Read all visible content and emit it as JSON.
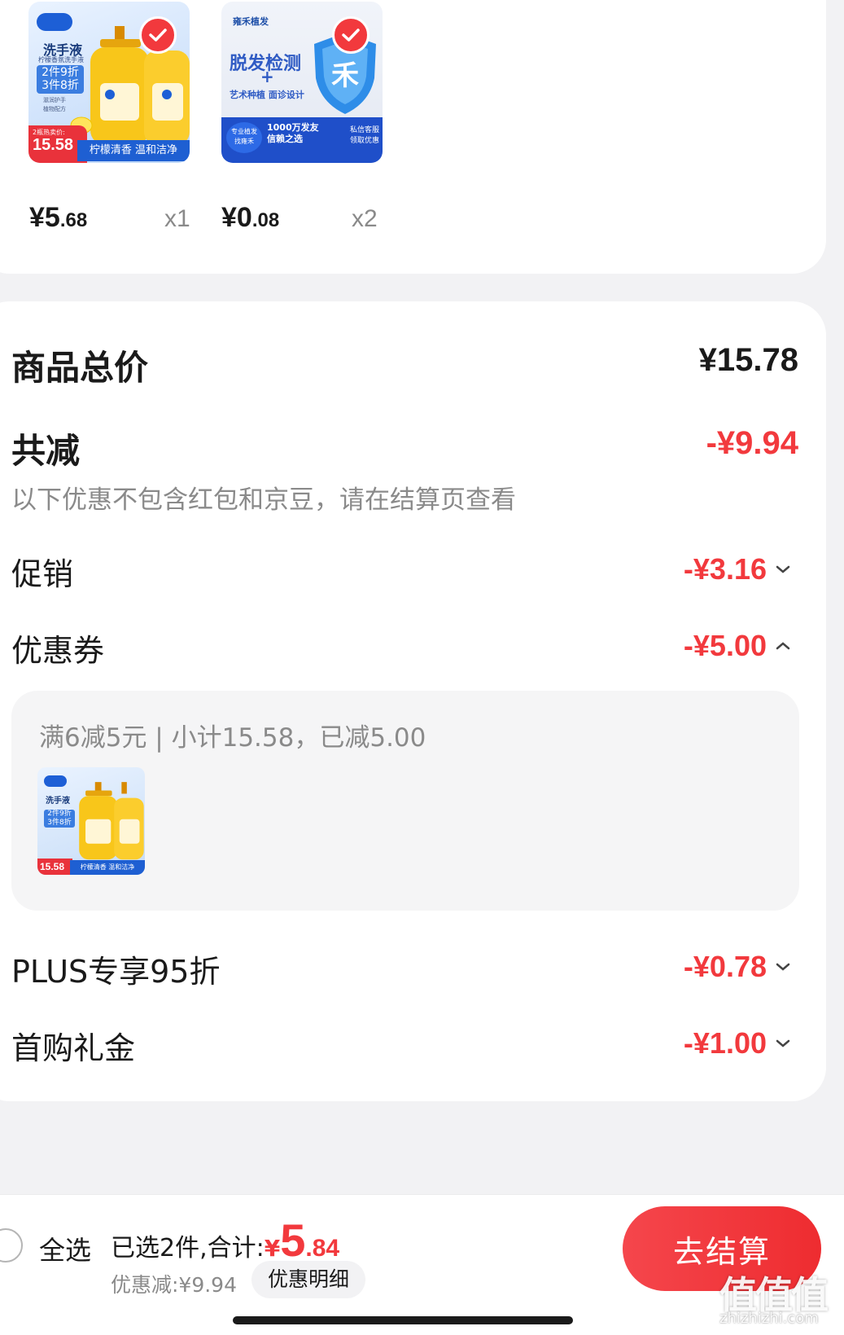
{
  "colors": {
    "accent": "#f2393d",
    "text": "#1a1a1a",
    "muted": "#8a8a8a"
  },
  "products": [
    {
      "badge": "洗手液",
      "sub": "柠檬香氛洗手液",
      "promo1": "2件9折",
      "promo2": "3件8折",
      "tag1": "滋润护手",
      "tag2": "植物配方",
      "price_tag_label": "2瓶热卖价:",
      "price_tag": "15.58",
      "banner": "柠檬清香 温和洁净",
      "price_int": "¥5",
      "price_dec": ".68",
      "qty": "x1"
    },
    {
      "brand": "雍禾植发",
      "title": "脱发检测",
      "plus": "+",
      "subtitle": "艺术种植 面诊设计",
      "chip1": "专业植发",
      "chip2": "找雍禾",
      "trust": "1000万发友",
      "trust2": "信赖之选",
      "service": "私信客服",
      "service2": "领取优惠",
      "price_int": "¥0",
      "price_dec": ".08",
      "qty": "x2"
    }
  ],
  "summary": {
    "total_label": "商品总价",
    "total_value": "¥15.78",
    "discount_label": "共减",
    "discount_value": "-¥9.94",
    "note": "以下优惠不包含红包和京豆，请在结算页查看",
    "rows": [
      {
        "label": "促销",
        "value": "-¥3.16"
      },
      {
        "label": "优惠券",
        "value": "-¥5.00"
      },
      {
        "label": "PLUS专享95折",
        "value": "-¥0.78"
      },
      {
        "label": "首购礼金",
        "value": "-¥1.00"
      }
    ],
    "coupon_detail": "满6减5元 | 小计15.58，已减5.00"
  },
  "bottom_bar": {
    "select_all": "全选",
    "selected_text": "已选2件,合计:",
    "total_symbol": "¥",
    "total_int": "5",
    "total_dec": ".84",
    "saved": "优惠减:¥9.94",
    "detail_button": "优惠明细",
    "checkout": "去结算"
  },
  "watermark": {
    "main": "值值值",
    "site": "zhizhizhi.com"
  }
}
